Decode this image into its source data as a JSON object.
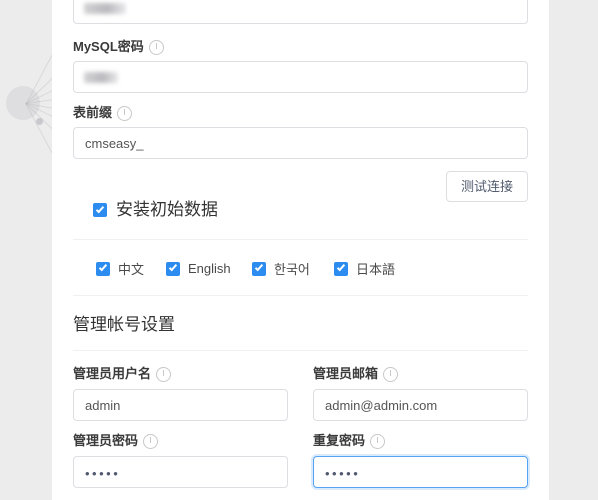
{
  "theme": {
    "accent": "#2d8cf0",
    "focus_border": "#57a3f3",
    "border": "#dcdee2",
    "page_bg": "#ececec",
    "panel_bg": "#ffffff",
    "text": "#3a3a3a"
  },
  "form": {
    "top_field": {
      "label": "",
      "value": "",
      "redacted": true
    },
    "mysql_password": {
      "label": "MySQL密码",
      "info_icon": "info-circle-icon",
      "value": "",
      "redacted": true
    },
    "table_prefix": {
      "label": "表前缀",
      "info_icon": "info-circle-icon",
      "value": "cmseasy_"
    },
    "test_connection_button": "测试连接"
  },
  "install_data": {
    "label": "安装初始数据",
    "checked": true
  },
  "languages": [
    {
      "label": "中文",
      "checked": true
    },
    {
      "label": "English",
      "checked": true
    },
    {
      "label": "한국어",
      "checked": true
    },
    {
      "label": "日本語",
      "checked": true
    }
  ],
  "admin_section": {
    "title": "管理帐号设置",
    "fields": {
      "username": {
        "label": "管理员用户名",
        "info_icon": "info-circle-icon",
        "value": "admin"
      },
      "email": {
        "label": "管理员邮箱",
        "info_icon": "info-circle-icon",
        "value": "admin@admin.com"
      },
      "password": {
        "label": "管理员密码",
        "info_icon": "info-circle-icon",
        "value": "•••••",
        "masked_length": 5
      },
      "password_repeat": {
        "label": "重复密码",
        "info_icon": "info-circle-icon",
        "value": "•••••",
        "masked_length": 5,
        "focused": true
      }
    }
  }
}
